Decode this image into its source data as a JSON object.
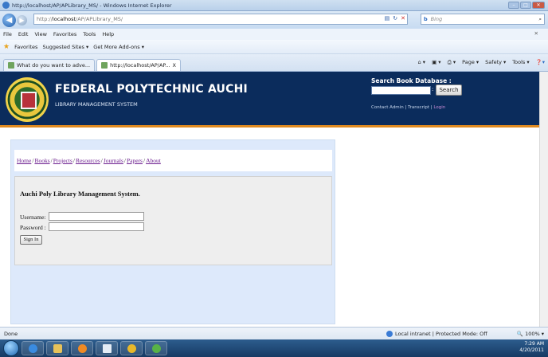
{
  "window": {
    "title": "http://localhost/AP/APLibrary_MS/ - Windows Internet Explorer"
  },
  "addressbar": {
    "url_prefix": "http://",
    "url_host": "localhost",
    "url_path": "/AP/APLibrary_MS/"
  },
  "searchbox": {
    "engine": "Bing",
    "placeholder": "Bing"
  },
  "menu": [
    "File",
    "Edit",
    "View",
    "Favorites",
    "Tools",
    "Help"
  ],
  "favorites": {
    "label": "Favorites",
    "items": [
      "Suggested Sites ▾",
      "Get More Add-ons ▾"
    ]
  },
  "tabs": [
    {
      "label": "What do you want to adve..."
    },
    {
      "label": "http://localhost/AP/AP...",
      "close": "X"
    }
  ],
  "commandbar": [
    "Page ▾",
    "Safety ▾",
    "Tools ▾"
  ],
  "site": {
    "title": "FEDERAL POLYTECHNIC AUCHI",
    "subtitle": "LIBRARY MANAGEMENT SYSTEM",
    "search_label": "Search Book Database :",
    "search_button": "Search",
    "links": {
      "contact": "Contact Admin",
      "sep": " | ",
      "transcript": "Transcript",
      "sep2": " | ",
      "login": "Login"
    }
  },
  "nav": [
    "Home",
    "Books",
    "Projects",
    "Resources",
    "Journals",
    "Papers",
    "About"
  ],
  "login": {
    "heading": "Auchi Poly Library Management System.",
    "username_label": "Username:",
    "password_label": "Password :",
    "submit": "Sign In"
  },
  "status": {
    "left": "Done",
    "zone": "Local intranet | Protected Mode: Off",
    "zoom": "100%"
  },
  "tray": {
    "time": "7:29 AM",
    "date": "4/20/2011"
  }
}
